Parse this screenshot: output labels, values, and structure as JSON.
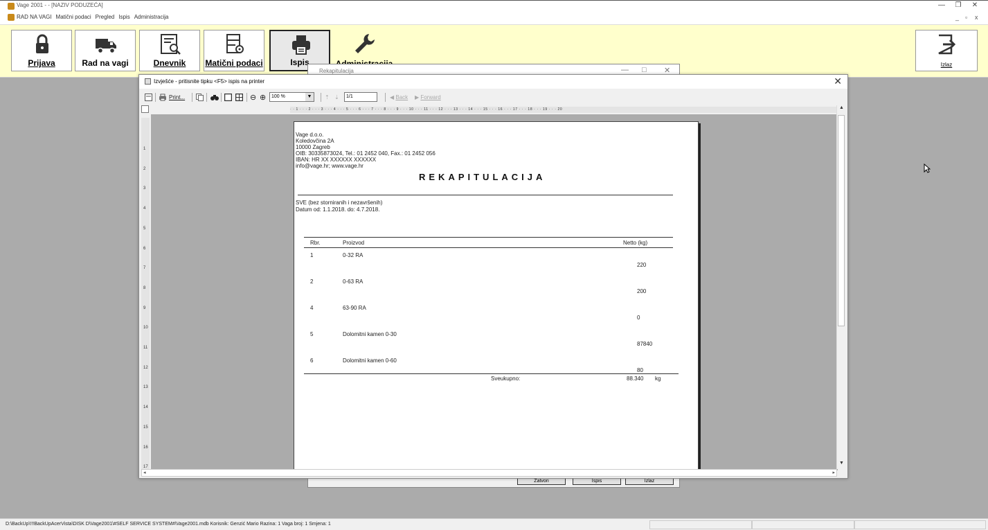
{
  "window": {
    "title": "Vage 2001 - - [NAZIV PODUZEĆA]",
    "controls": [
      "—",
      "❐",
      "✕"
    ]
  },
  "menu": {
    "items": [
      "RAD NA VAGI",
      "Matični podaci",
      "Pregled",
      "Ispis",
      "Administracija"
    ],
    "mdi_controls": [
      "_",
      "▫",
      "x"
    ]
  },
  "toolbar": {
    "buttons": [
      {
        "label": "Prijava",
        "icon": "lock-icon"
      },
      {
        "label": "Rad na vagi",
        "icon": "truck-icon"
      },
      {
        "label": "Dnevnik",
        "icon": "log-search-icon"
      },
      {
        "label": "Matični podaci",
        "icon": "document-settings-icon"
      },
      {
        "label": "Ispis",
        "icon": "printer-icon"
      },
      {
        "label": "Administracija",
        "icon": "wrench-icon"
      }
    ],
    "exit_label": "Izlaz",
    "colors": {
      "background": "#ffffcc"
    }
  },
  "behind_window": {
    "title": "Rekapitulacija",
    "controls": [
      "—",
      "□",
      "✕"
    ],
    "buttons": [
      "Zatvori",
      "Ispis",
      "Izlaz"
    ]
  },
  "preview": {
    "title": "Izvješće - pritisnite tipku <F5> ispis na printer",
    "close": "✕",
    "tools": {
      "print": "Print...",
      "zoom": "100 %",
      "page": "1/1",
      "back": "Back",
      "forward": "Forward"
    },
    "ruler_h": "· · 1 · · · 2 · · · 3 · · · 4 · · · 5 · · · 6 · · · 7 · · · 8 · · · 9 · · · 10 · · · 11 · · · 12 · · · 13 · · · 14 · · · 15 · · · 16 · · · 17 · · · 18 · · · 19 · · · 20",
    "ruler_v": [
      "1",
      "2",
      "3",
      "4",
      "5",
      "6",
      "7",
      "8",
      "9",
      "10",
      "11",
      "12",
      "13",
      "14",
      "15",
      "16",
      "17"
    ]
  },
  "report": {
    "company": [
      "Vage d.o.o.",
      "Koledovčina 2A",
      "10000 Zagreb",
      "OIB: 30335873024, Tel.: 01 2452 040, Fax.: 01 2452 056",
      "IBAN: HR XX XXXXXX XXXXXX",
      "info@vage.hr;  www.vage.hr"
    ],
    "heading": "REKAPITULACIJA",
    "filter": "SVE (bez storniranih i nezavršenih)",
    "date_range": "Datum od: 1.1.2018. do: 4.7.2018.",
    "columns": {
      "rbr": "Rbr.",
      "product": "Proizvod",
      "netto": "Netto (kg)"
    },
    "rows": [
      {
        "rbr": "1",
        "product": "0-32 RA",
        "netto": "220"
      },
      {
        "rbr": "2",
        "product": "0-63 RA",
        "netto": "200"
      },
      {
        "rbr": "4",
        "product": "63-90 RA",
        "netto": "0"
      },
      {
        "rbr": "5",
        "product": "Dolomitni kamen 0-30",
        "netto": "87840"
      },
      {
        "rbr": "6",
        "product": "Dolomitni kamen 0-60",
        "netto": "80"
      }
    ],
    "total_label": "Sveukupno:",
    "total_value": "88.340",
    "total_unit": "kg"
  },
  "statusbar": {
    "text": "D:\\BackUp\\!!!BackUpAcerVista\\DISK D\\Vage2001\\#SELF SERVICE SYSTEM#\\Vage2001.mdb  Korisnik: Genzić Mario  Razina: 1  Vaga broj: 1   Smjena: 1"
  }
}
